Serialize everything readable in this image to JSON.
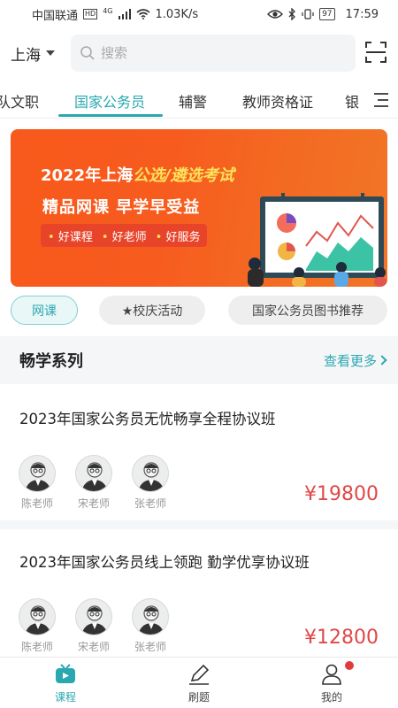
{
  "status_bar": {
    "carrier": "中国联通",
    "hd_badge": "HD",
    "network_type": "4G",
    "speed": "1.03K/s",
    "battery": "97",
    "time": "17:59"
  },
  "header": {
    "city": "上海",
    "search_placeholder": "搜索",
    "icons": [
      "search-icon",
      "scan-icon",
      "chevron-down-icon"
    ]
  },
  "tabs": {
    "items": [
      {
        "label": "队文职"
      },
      {
        "label": "国家公务员"
      },
      {
        "label": "辅警"
      },
      {
        "label": "教师资格证"
      },
      {
        "label": "银"
      }
    ],
    "active_index": 1,
    "accent_color": "#2aa8b0"
  },
  "banner": {
    "title_prefix": "2022年上海",
    "title_highlight": "公选/遴选考试",
    "subtitle": "精品网课  早学早受益",
    "tags": [
      "好课程",
      "好老师",
      "好服务"
    ],
    "background_color": "#f75b1e"
  },
  "chips": {
    "items": [
      {
        "label": "网课"
      },
      {
        "label": "★校庆活动"
      },
      {
        "label": "国家公务员图书推荐"
      }
    ],
    "active_index": 0
  },
  "section": {
    "title": "畅学系列",
    "more_label": "查看更多"
  },
  "courses": [
    {
      "title": "2023年国家公务员无忧畅享全程协议班",
      "teachers": [
        "陈老师",
        "宋老师",
        "张老师"
      ],
      "price": "¥19800"
    },
    {
      "title": "2023年国家公务员线上领跑 勤学优享协议班",
      "teachers": [
        "陈老师",
        "宋老师",
        "张老师"
      ],
      "price": "¥12800"
    }
  ],
  "bottom_nav": {
    "items": [
      {
        "label": "课程",
        "icon": "tv-icon"
      },
      {
        "label": "刷题",
        "icon": "pencil-icon"
      },
      {
        "label": "我的",
        "icon": "user-icon"
      }
    ],
    "active_index": 0,
    "price_color": "#e04848"
  }
}
